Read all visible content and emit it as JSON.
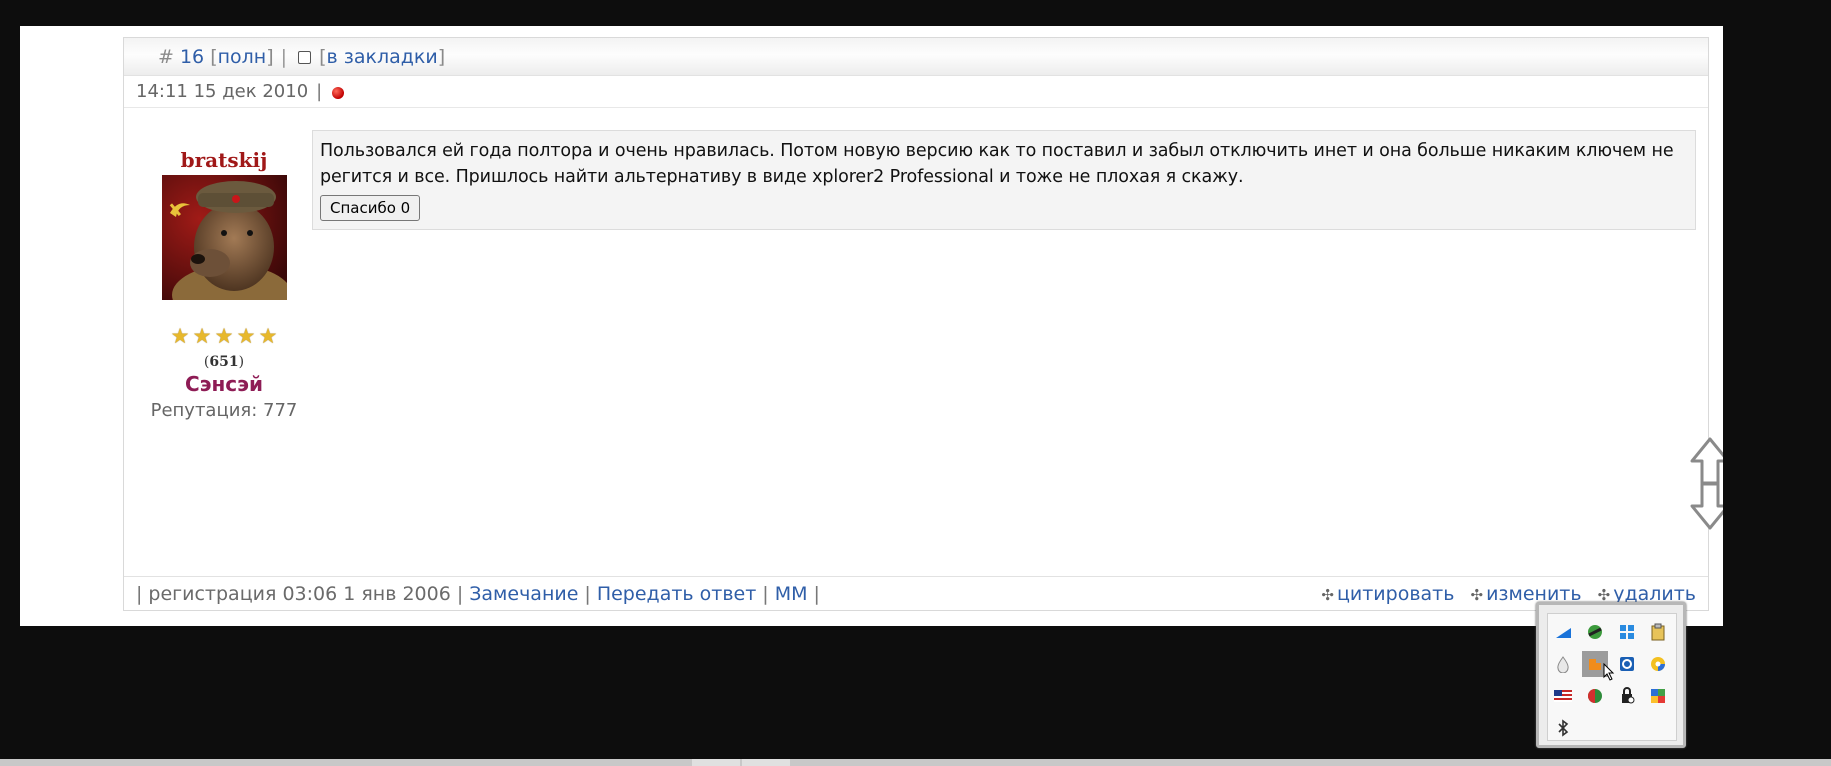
{
  "post": {
    "hash": "#",
    "number": "16",
    "full_link": "полн",
    "bookmark_link": "в закладки",
    "date": "14:11 15 дек 2010",
    "separator": "|"
  },
  "user": {
    "name": "bratskij",
    "stars": 5,
    "message_count": "651",
    "rank": "Сэнсэй",
    "reputation": "Репутация: 777"
  },
  "message": {
    "text": "Пользовался ей года полтора и очень нравилась. Потом новую версию как то поставил и забыл отключить инет и она больше никаким ключем не регится и все. Пришлось найти альтернативу в виде xplorer2 Professional и тоже не плохая я скажу.",
    "thanks_button": "Спасибо 0"
  },
  "footer": {
    "registration": "регистрация 03:06 1 янв 2006",
    "links": [
      "Замечание",
      "Передать ответ",
      "ММ"
    ],
    "actions": [
      "цитировать",
      "изменить",
      "удалить"
    ]
  },
  "colors": {
    "link": "#2f5ea8",
    "username": "#a01818",
    "rank": "#8e1c55",
    "star": "#e7b82c"
  },
  "tray_icons": [
    "network-signal-icon",
    "green-globe-icon",
    "windows-flag-icon",
    "clipboard-icon",
    "water-drop-icon",
    "orange-puzzle-icon",
    "blue-shield-icon",
    "color-wheel-icon",
    "us-flag-icon",
    "red-green-circle-icon",
    "usb-lock-icon",
    "multicolor-app-icon",
    "bluetooth-icon"
  ]
}
